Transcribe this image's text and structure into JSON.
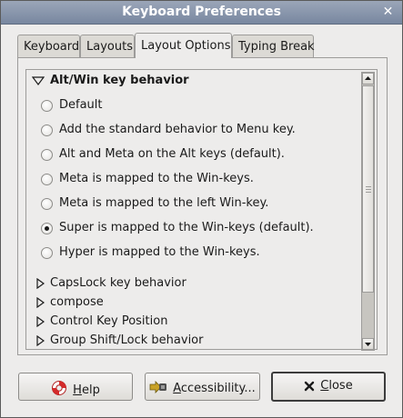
{
  "window": {
    "title": "Keyboard Preferences",
    "close_glyph": "✕"
  },
  "tabs": [
    {
      "label": "Keyboard",
      "active": false
    },
    {
      "label": "Layouts",
      "active": false
    },
    {
      "label": "Layout Options",
      "active": true
    },
    {
      "label": "Typing Break",
      "active": false
    }
  ],
  "options": {
    "expanded_group": {
      "title": "Alt/Win key behavior",
      "items": [
        {
          "label": "Default",
          "checked": false
        },
        {
          "label": "Add the standard behavior to Menu key.",
          "checked": false
        },
        {
          "label": "Alt and Meta on the Alt keys (default).",
          "checked": false
        },
        {
          "label": "Meta is mapped to the Win-keys.",
          "checked": false
        },
        {
          "label": "Meta is mapped to the left Win-key.",
          "checked": false
        },
        {
          "label": "Super is mapped to the Win-keys (default).",
          "checked": true
        },
        {
          "label": "Hyper is mapped to the Win-keys.",
          "checked": false
        }
      ]
    },
    "collapsed_groups": [
      "CapsLock key behavior",
      "compose",
      "Control Key Position",
      "Group Shift/Lock behavior"
    ]
  },
  "buttons": {
    "help": {
      "pre": "",
      "mnemonic": "H",
      "post": "elp",
      "icon": "lifebuoy-icon"
    },
    "accessibility": {
      "pre": "",
      "mnemonic": "A",
      "post": "ccessibility...",
      "icon": "accessibility-icon"
    },
    "close": {
      "pre": "",
      "mnemonic": "C",
      "post": "lose",
      "icon": "close-x-icon"
    }
  }
}
